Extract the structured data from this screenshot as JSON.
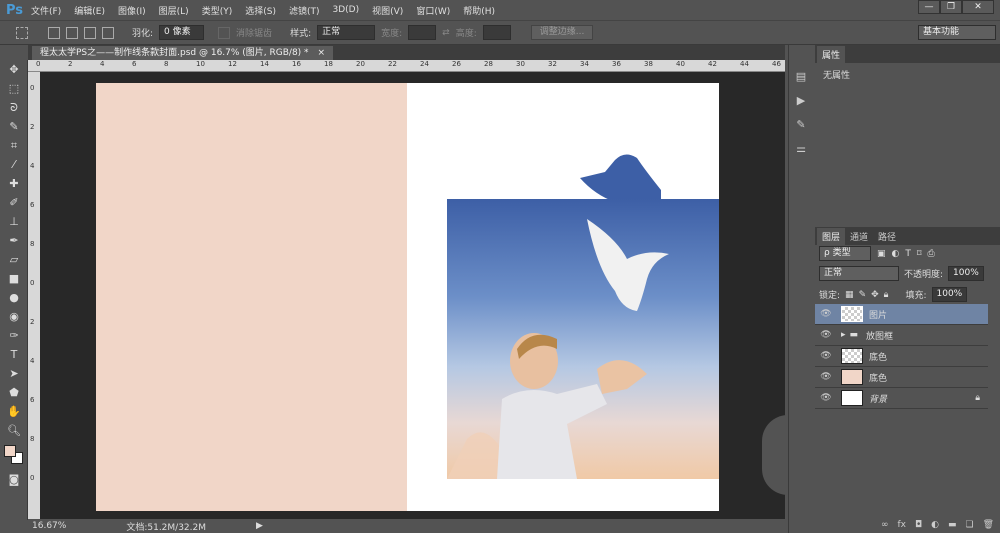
{
  "app": {
    "logo": "Ps"
  },
  "menu": [
    "文件(F)",
    "编辑(E)",
    "图像(I)",
    "图层(L)",
    "类型(Y)",
    "选择(S)",
    "滤镜(T)",
    "3D(D)",
    "视图(V)",
    "窗口(W)",
    "帮助(H)"
  ],
  "window": {
    "minimize": "—",
    "restore": "❐",
    "close": "✕"
  },
  "options": {
    "feather_label": "羽化:",
    "feather_value": "0 像素",
    "antialias": "消除锯齿",
    "style_label": "样式:",
    "style_value": "正常",
    "width_label": "宽度:",
    "height_label": "高度:",
    "refine_edge": "调整边缘...",
    "workspace": "基本功能"
  },
  "document": {
    "tab": "程太太学PS之——制作线条款封面.psd @ 16.7% (图片, RGB/8) *",
    "close": "×"
  },
  "ruler": {
    "top": [
      "0",
      "2",
      "4",
      "6",
      "8",
      "10",
      "12",
      "14",
      "16",
      "18",
      "20",
      "22",
      "24",
      "26",
      "28",
      "30",
      "32",
      "34",
      "36",
      "38",
      "40",
      "42",
      "44",
      "46"
    ],
    "left": [
      "0",
      "2",
      "4",
      "6",
      "8",
      "0",
      "2",
      "4",
      "6",
      "8",
      "0"
    ]
  },
  "status": {
    "zoom": "16.67%",
    "doc": "文档:51.2M/32.2M"
  },
  "properties": {
    "tab": "属性",
    "text": "无属性"
  },
  "layers": {
    "tabs": [
      "图层",
      "通道",
      "路径"
    ],
    "filter": "ρ 类型",
    "blend": "正常",
    "opacity_label": "不透明度:",
    "opacity": "100%",
    "lock_label": "锁定:",
    "fill_label": "填充:",
    "fill": "100%",
    "items": [
      {
        "name": "图片",
        "type": "image",
        "selected": true
      },
      {
        "name": "放图框",
        "type": "group"
      },
      {
        "name": "底色",
        "type": "transparent"
      },
      {
        "name": "底色",
        "type": "peach"
      },
      {
        "name": "背景",
        "type": "background",
        "locked": true
      }
    ]
  },
  "colors": {
    "peach": "#f1d6c8",
    "accent": "#4a9bd6",
    "selected": "#6f84a4"
  }
}
